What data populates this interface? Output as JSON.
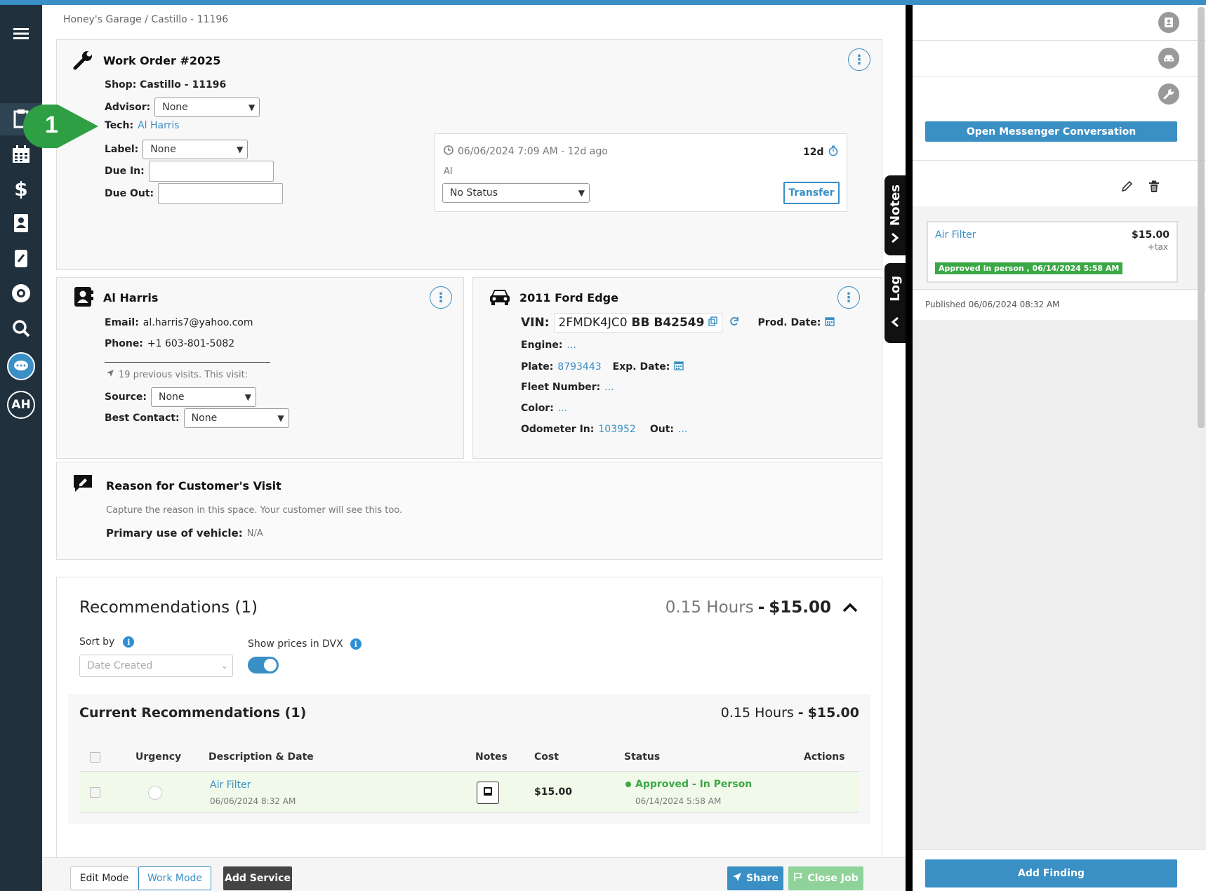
{
  "breadcrumb": "Honey's Garage / Castillo - 11196",
  "work_order": {
    "title": "Work Order #2025",
    "shop": "Shop: Castillo - 11196",
    "advisor_label": "Advisor:",
    "advisor_value": "None",
    "tech_label": "Tech:",
    "tech_value": "Al Harris",
    "label_label": "Label:",
    "label_value": "None",
    "due_in_label": "Due In:",
    "due_out_label": "Due Out:",
    "status_box": {
      "datetime": "06/06/2024 7:09 AM - 12d ago",
      "age": "12d",
      "initials": "AI",
      "status_value": "No Status",
      "transfer_label": "Transfer"
    }
  },
  "annotation": {
    "number": "1"
  },
  "customer": {
    "name": "Al Harris",
    "email_label": "Email:",
    "email": "al.harris7@yahoo.com",
    "phone_label": "Phone:",
    "phone": "+1 603-801-5082",
    "visits": "19 previous visits. This visit:",
    "source_label": "Source:",
    "source_value": "None",
    "best_contact_label": "Best Contact:",
    "best_contact_value": "None"
  },
  "vehicle": {
    "title": "2011 Ford Edge",
    "vin_label": "VIN:",
    "vin_prefix": "2FMDK4JC0",
    "vin_suffix": "BB B42549",
    "prod_date_label": "Prod. Date:",
    "engine_label": "Engine:",
    "engine_value": "...",
    "plate_label": "Plate:",
    "plate_value": "8793443",
    "exp_date_label": "Exp. Date:",
    "fleet_label": "Fleet Number:",
    "fleet_value": "...",
    "color_label": "Color:",
    "color_value": "...",
    "odometer_in_label": "Odometer In:",
    "odometer_in_value": "103952",
    "out_label": "Out:",
    "out_value": "..."
  },
  "reason": {
    "title": "Reason for Customer's Visit",
    "placeholder": "Capture the reason in this space. Your customer will see this too.",
    "primary_use_label": "Primary use of vehicle:",
    "primary_use_value": "N/A"
  },
  "recommendations": {
    "title": "Recommendations (1)",
    "hours": "0.15 Hours",
    "sep": "-",
    "total": "$15.00",
    "sort_by_label": "Sort by",
    "sort_value": "Date Created",
    "show_prices_label": "Show prices in DVX",
    "show_prices_on": true,
    "current": {
      "title": "Current Recommendations (1)",
      "hours": "0.15 Hours",
      "sep": "-",
      "total": "$15.00",
      "columns": [
        "Urgency",
        "Description & Date",
        "Notes",
        "Cost",
        "Status",
        "Actions"
      ],
      "rows": [
        {
          "description": "Air Filter",
          "date": "06/06/2024 8:32 AM",
          "cost": "$15.00",
          "status": "Approved - In Person",
          "status_date": "06/14/2024 5:58 AM"
        }
      ]
    }
  },
  "footer": {
    "edit_mode": "Edit Mode",
    "work_mode": "Work Mode",
    "add_service": "Add Service",
    "share": "Share",
    "close_job": "Close Job"
  },
  "right_panel": {
    "messenger_button": "Open Messenger Conversation",
    "notes_tab": "Notes",
    "log_tab": "Log",
    "finding": {
      "name": "Air Filter",
      "price": "$15.00",
      "tax": "+tax",
      "badge": "Approved in person , 06/14/2024 5:58 AM"
    },
    "published": "Published 06/06/2024 08:32 AM",
    "add_finding": "Add Finding"
  },
  "colors": {
    "accent": "#3a8fc5",
    "sidebar": "#20303c",
    "approved_green": "#3aa845",
    "annotation_green": "#2ea043"
  }
}
